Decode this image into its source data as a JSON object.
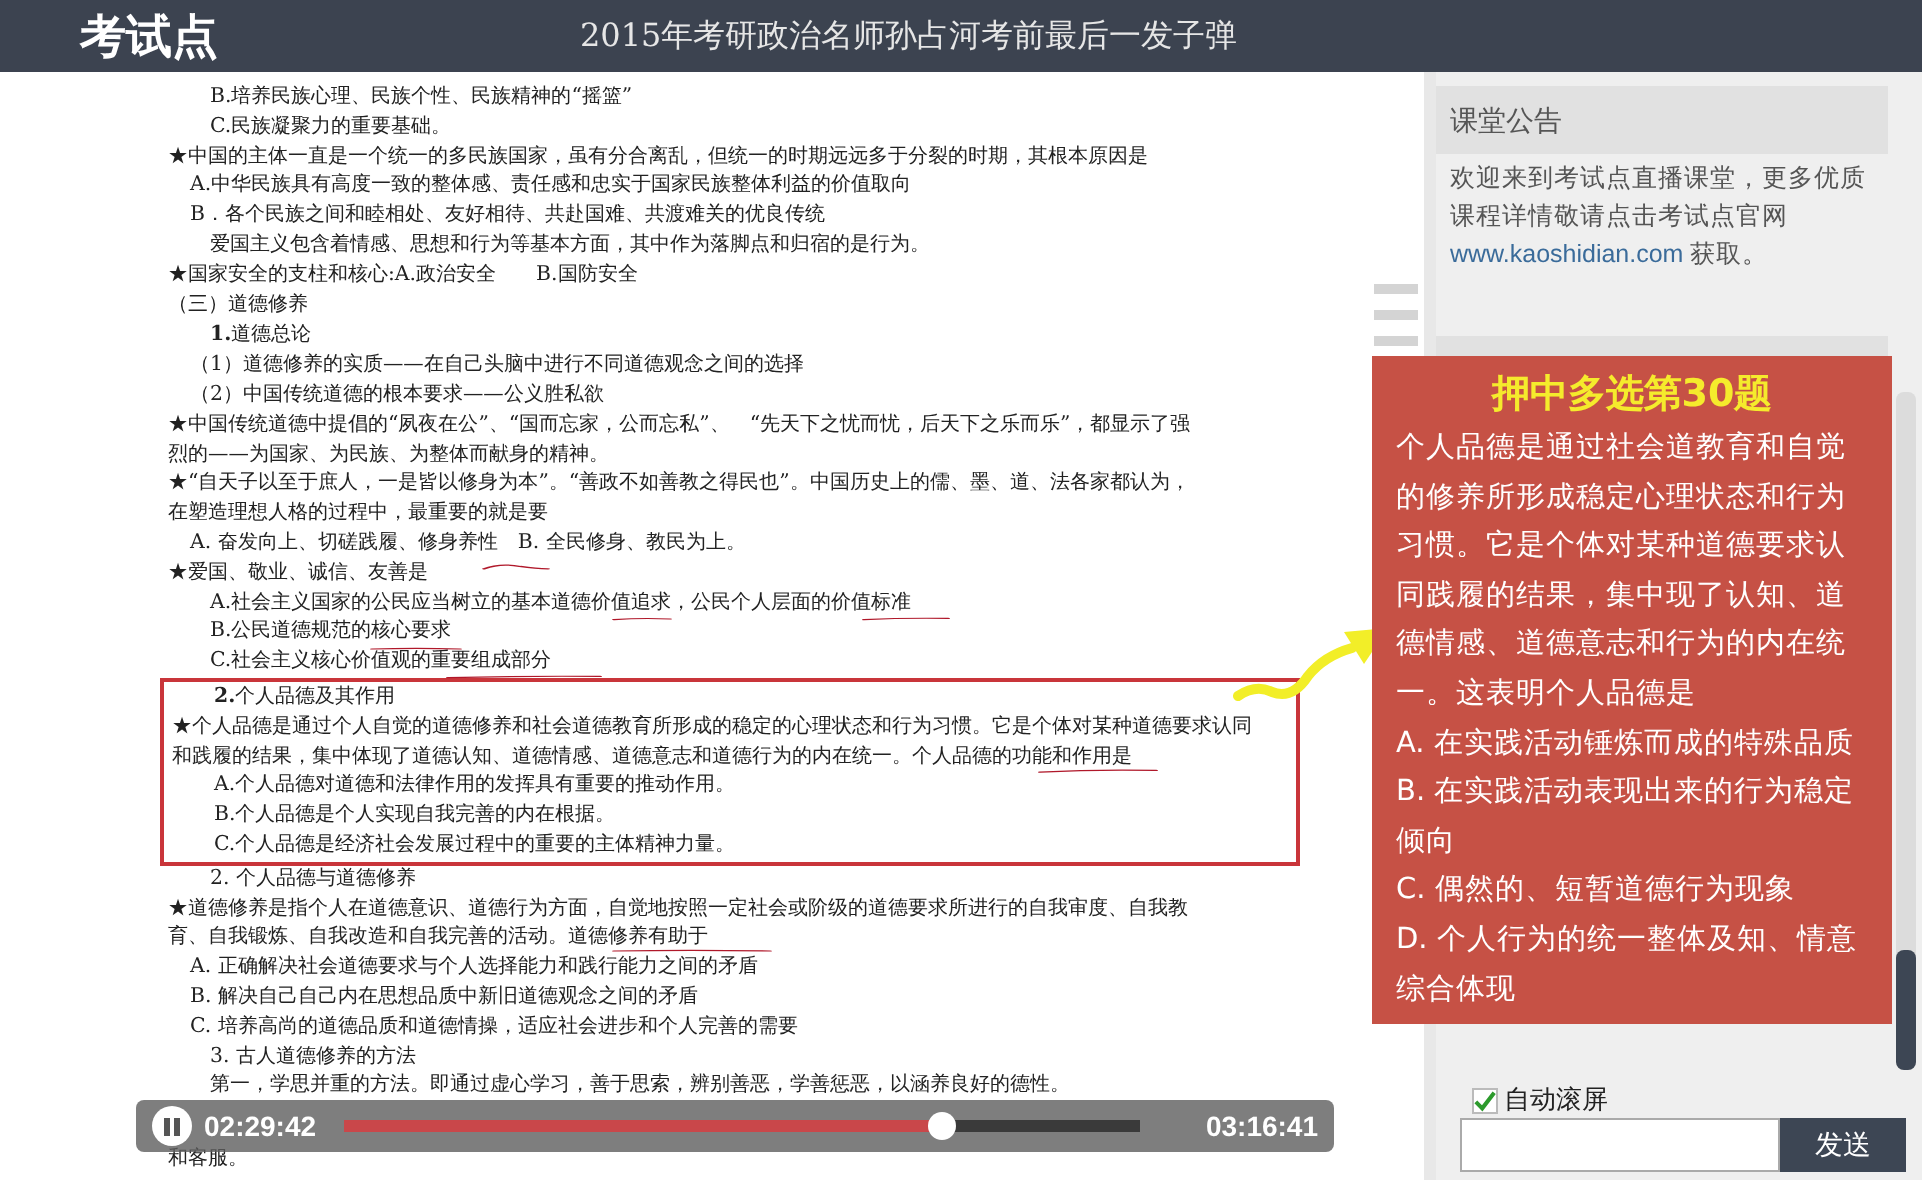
{
  "header": {
    "logo": "考试点",
    "title": "2015年考研政治名师孙占河考前最后一发子弹"
  },
  "document": {
    "before": [
      {
        "kind": "deep",
        "text": "B.培养民族心理、民族个性、民族精神的“摇篮”"
      },
      {
        "kind": "deep",
        "text": "C.民族凝聚力的重要基础。"
      },
      {
        "kind": "flush",
        "text": "★中国的主体一直是一个统一的多民族国家，虽有分合离乱，但统一的时期远远多于分裂的时期，其根本原因是"
      },
      {
        "kind": "indent",
        "text": "A.中华民族具有高度一致的整体感、责任感和忠实于国家民族整体利益的价值取向"
      },
      {
        "kind": "indent",
        "text": "B．各个民族之间和睦相处、友好相待、共赴国难、共渡难关的优良传统"
      },
      {
        "kind": "deep",
        "text": "爱国主义包含着情感、思想和行为等基本方面，其中作为落脚点和归宿的是行为。"
      },
      {
        "kind": "flush",
        "text": "★国家安全的支柱和核心:A.政治安全　　B.国防安全"
      },
      {
        "kind": "flush",
        "text": "（三）道德修养"
      },
      {
        "kind": "deep",
        "text": "**1.**道德总论"
      },
      {
        "kind": "indent",
        "text": "（1）道德修养的实质——在自己头脑中进行不同道德观念之间的选择"
      },
      {
        "kind": "indent",
        "text": "（2）中国传统道德的根本要求——公义胜私欲"
      },
      {
        "kind": "flush",
        "text": "★中国传统道德中提倡的“夙夜在公”、“国而忘家，公而忘私”、　“先天下之忧而忧，后天下之乐而乐”，都显示了强"
      },
      {
        "kind": "flush",
        "text": "烈的——为国家、为民族、为整体而献身的精神。"
      },
      {
        "kind": "flush",
        "text": "★“自天子以至于庶人，一是皆以修身为本”。“善政不如善教之得民也”。中国历史上的儒、墨、道、法各家都认为，"
      },
      {
        "kind": "flush",
        "text": "在塑造理想人格的过程中，最重要的就是要"
      },
      {
        "kind": "indent",
        "text": "A. 奋发向上、切磋践履、修身养性　B. 全民修身、教民为上。"
      },
      {
        "kind": "flush",
        "text": "★爱国、敬业、诚信、友善是"
      },
      {
        "kind": "deep",
        "text": "A.社会主义国家的公民应当树立的基本道德价值追求，公民个人层面的价值标准"
      },
      {
        "kind": "deep",
        "text": "B.公民道德规范的核心要求"
      },
      {
        "kind": "deep",
        "text": "C.社会主义核心价值观的重要组成部分"
      }
    ],
    "boxed": [
      {
        "kind": "deep",
        "text": "**2.**个人品德及其作用"
      },
      {
        "kind": "flush",
        "text": "★个人品德是通过个人自觉的道德修养和社会道德教育所形成的稳定的心理状态和行为习惯。它是个体对某种道德要求认同和践履的结果，集中体现了道德认知、道德情感、道德意志和道德行为的内在统一。个人品德的功能和作用是"
      },
      {
        "kind": "deep",
        "text": "A.个人品德对道德和法律作用的发挥具有重要的推动作用。"
      },
      {
        "kind": "deep",
        "text": "B.个人品德是个人实现自我完善的内在根据。"
      },
      {
        "kind": "deep",
        "text": "C.个人品德是经济社会发展过程中的重要的主体精神力量。"
      }
    ],
    "after": [
      {
        "kind": "deep",
        "text": "2. 个人品德与道德修养"
      },
      {
        "kind": "flush",
        "text": "★道德修养是指个人在道德意识、道德行为方面，自觉地按照一定社会或阶级的道德要求所进行的自我审度、自我教"
      },
      {
        "kind": "flush",
        "text": "育、自我锻炼、自我改造和自我完善的活动。道德修养有助于"
      },
      {
        "kind": "indent",
        "text": "A. 正确解决社会道德要求与个人选择能力和践行能力之间的矛盾"
      },
      {
        "kind": "indent",
        "text": "B. 解决自己自己内在思想品质中新旧道德观念之间的矛盾"
      },
      {
        "kind": "indent",
        "text": "C. 培养高尚的道德品质和道德情操，适应社会进步和个人完善的需要"
      },
      {
        "kind": "deep",
        "text": "3. 古人道德修养的方法"
      },
      {
        "kind": "deep",
        "text": "第一，学思并重的方法。即通过虚心学习，善于思索，辨别善恶，学善惩恶，以涵养良好的德性。"
      },
      {
        "kind": "gap"
      },
      {
        "kind": "flush",
        "text": "和客服。"
      }
    ]
  },
  "player": {
    "elapsed": "02:29:42",
    "total": "03:16:41",
    "level": 0.75,
    "playing": true
  },
  "announcement": {
    "title": "课堂公告",
    "text": "欢迎来到考试点直播课堂，更多优质课程详情敬请点击考试点官网",
    "link": "www.kaoshidian.com",
    "suffix": " 获取。"
  },
  "chat": {
    "auto_scroll": {
      "label": "自动滚屏",
      "checked": true
    },
    "send": "发送"
  },
  "callout": {
    "title": "押中多选第30题",
    "body": "个人品德是通过社会道教育和自觉的修养所形成稳定心理状态和行为习惯。它是个体对某种道德要求认同践履的结果，集中现了认知、道德情感、道德意志和行为的内在统一。这表明个人品德是",
    "options": [
      "A. 在实践活动锤炼而成的特殊品质",
      "B. 在实践活动表现出来的行为稳定倾向",
      "C. 偶然的、短暂道德行为现象",
      "D. 个人行为的统一整体及知、情意综合体现"
    ]
  }
}
